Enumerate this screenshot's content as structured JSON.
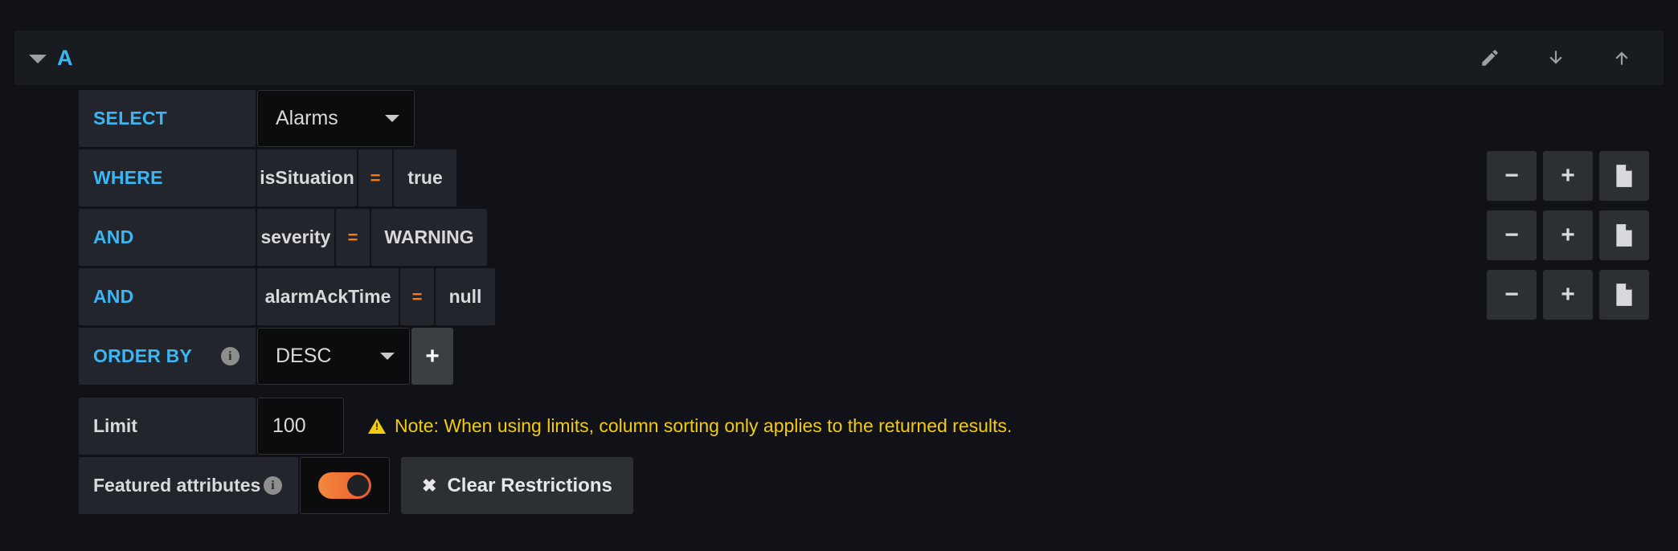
{
  "header": {
    "ref_id": "A",
    "collapse_icon": "chevron-down-icon",
    "actions": [
      {
        "icon": "pencil-icon",
        "name": "edit-query-button"
      },
      {
        "icon": "arrow-down-icon",
        "name": "move-query-down-button"
      },
      {
        "icon": "arrow-up-icon",
        "name": "move-query-up-button"
      }
    ]
  },
  "query": {
    "select": {
      "keyword": "SELECT",
      "value": "Alarms"
    },
    "conditions": [
      {
        "keyword": "WHERE",
        "field": "isSituation",
        "operator": "=",
        "value": "true"
      },
      {
        "keyword": "AND",
        "field": "severity",
        "operator": "=",
        "value": "WARNING"
      },
      {
        "keyword": "AND",
        "field": "alarmAckTime",
        "operator": "=",
        "value": "null"
      }
    ],
    "order_by": {
      "keyword": "ORDER BY",
      "info": "i",
      "value": "DESC",
      "add_label": "+"
    },
    "limit": {
      "label": "Limit",
      "value": "100",
      "note": "Note: When using limits, column sorting only applies to the returned results."
    },
    "featured": {
      "label": "Featured attributes",
      "info": "i",
      "toggle_on": true,
      "clear_label": "Clear Restrictions",
      "clear_icon": "✖"
    }
  },
  "side_actions": {
    "rows": [
      {
        "remove": "−",
        "add": "+",
        "duplicate": "document-icon"
      },
      {
        "remove": "−",
        "add": "+",
        "duplicate": "document-icon"
      },
      {
        "remove": "−",
        "add": "+",
        "duplicate": "document-icon"
      }
    ]
  },
  "colors": {
    "accent_blue": "#3ab6f5",
    "operator_orange": "#ff780a",
    "warning_yellow": "#f2cc0c",
    "toggle_orange": "#ec5b2c",
    "panel_bg": "#181b1f",
    "cell_bg": "#22252b",
    "input_bg": "#0b0c0e"
  }
}
